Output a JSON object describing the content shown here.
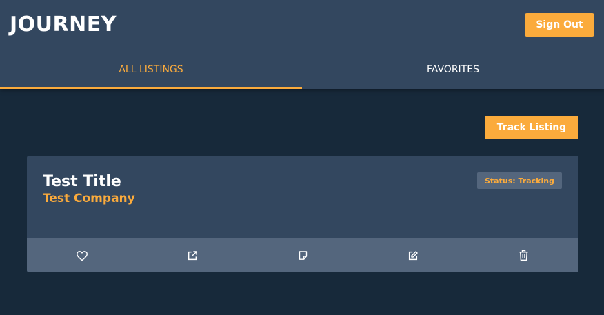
{
  "app": {
    "title": "JOURNEY",
    "accent_color": "#fbab3c",
    "header_color": "#33475f",
    "background_color": "#17293a"
  },
  "header": {
    "sign_out_label": "Sign Out"
  },
  "tabs": [
    {
      "label": "ALL LISTINGS",
      "active": true
    },
    {
      "label": "FAVORITES",
      "active": false
    }
  ],
  "toolbar": {
    "track_label": "Track Listing"
  },
  "listings": [
    {
      "title": "Test Title",
      "company": "Test Company",
      "status": "Status: Tracking",
      "actions": [
        {
          "icon": "heart-icon"
        },
        {
          "icon": "external-link-icon"
        },
        {
          "icon": "note-icon"
        },
        {
          "icon": "edit-icon"
        },
        {
          "icon": "trash-icon"
        }
      ]
    }
  ]
}
